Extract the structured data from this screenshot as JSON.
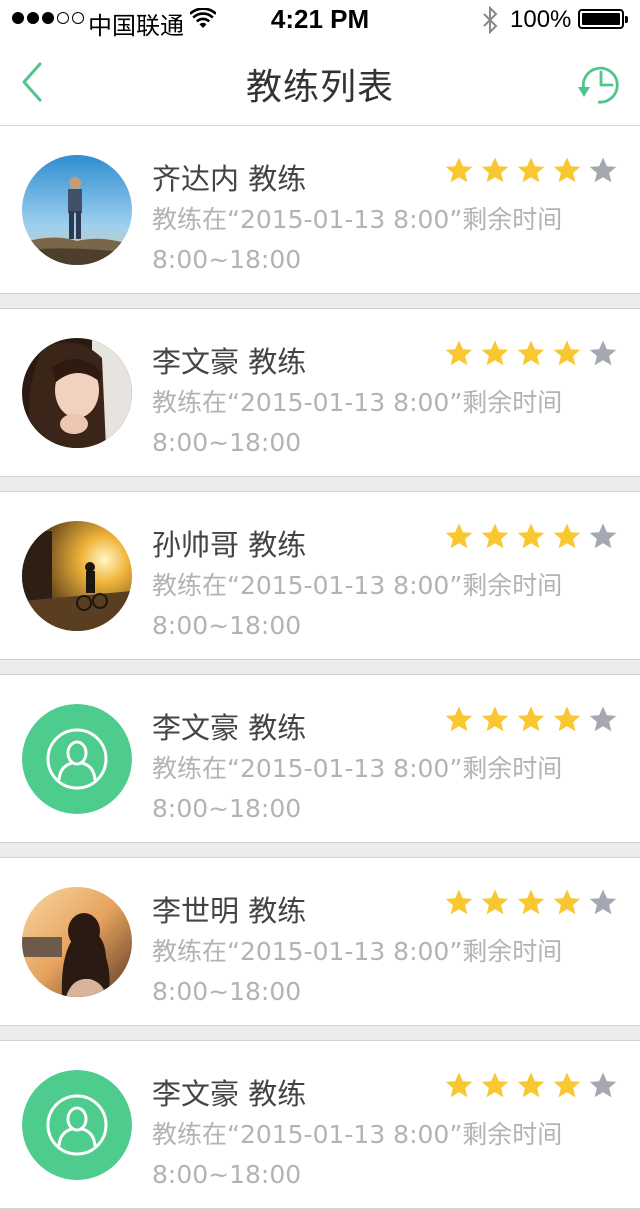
{
  "status_bar": {
    "carrier": "中国联通",
    "time": "4:21 PM",
    "battery": "100%",
    "signal_bars_full": 3,
    "signal_bars_total": 5
  },
  "nav": {
    "title": "教练列表",
    "back_icon": "back-chevron-icon",
    "history_icon": "clock-history-icon",
    "accent_color": "#4cc689"
  },
  "colors": {
    "star_filled": "#f9c831",
    "star_empty": "#a5a8b1",
    "default_avatar_bg": "#4dcc8e",
    "separator": "#ececec"
  },
  "coaches": [
    {
      "name": "齐达内 教练",
      "info_line1": "教练在“2015-01-13 8:00”剩余时间",
      "info_line2": "8:00~18:00",
      "rating": 4,
      "rating_max": 5,
      "avatar": "photo-man-standing"
    },
    {
      "name": "李文豪 教练",
      "info_line1": "教练在“2015-01-13 8:00”剩余时间",
      "info_line2": "8:00~18:00",
      "rating": 4,
      "rating_max": 5,
      "avatar": "photo-woman-portrait"
    },
    {
      "name": "孙帅哥 教练",
      "info_line1": "教练在“2015-01-13 8:00”剩余时间",
      "info_line2": "8:00~18:00",
      "rating": 4,
      "rating_max": 5,
      "avatar": "photo-cyclist-sunset"
    },
    {
      "name": "李文豪 教练",
      "info_line1": "教练在“2015-01-13 8:00”剩余时间",
      "info_line2": "8:00~18:00",
      "rating": 4,
      "rating_max": 5,
      "avatar": "default-user-icon"
    },
    {
      "name": "李世明 教练",
      "info_line1": "教练在“2015-01-13 8:00”剩余时间",
      "info_line2": "8:00~18:00",
      "rating": 4,
      "rating_max": 5,
      "avatar": "photo-woman-back-sunset"
    },
    {
      "name": "李文豪 教练",
      "info_line1": "教练在“2015-01-13 8:00”剩余时间",
      "info_line2": "8:00~18:00",
      "rating": 4,
      "rating_max": 5,
      "avatar": "default-user-icon"
    }
  ]
}
